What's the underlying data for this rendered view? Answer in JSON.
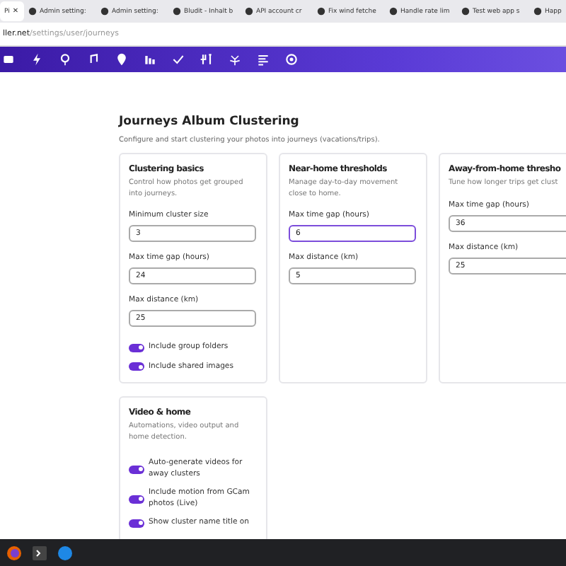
{
  "browser": {
    "tabs": [
      {
        "label": "Pi",
        "selected": true,
        "close": "✕"
      },
      {
        "label": "Admin setting:",
        "selected": false
      },
      {
        "label": "Admin setting:",
        "selected": false
      },
      {
        "label": "Bludit - Inhalt b",
        "selected": false
      },
      {
        "label": "API account cr",
        "selected": false
      },
      {
        "label": "Fix wind fetche",
        "selected": false
      },
      {
        "label": "Handle rate lim",
        "selected": false
      },
      {
        "label": "Test web app s",
        "selected": false
      },
      {
        "label": "Happ",
        "selected": false
      }
    ],
    "address": {
      "host": "ller.net",
      "path": "/settings/user/journeys"
    }
  },
  "page": {
    "title": "Journeys Album Clustering",
    "subtitle": "Configure and start clustering your photos into journeys (vacations/trips).",
    "cards": [
      {
        "title": "Clustering basics",
        "description": "Control how photos get grouped into journeys.",
        "fields": [
          {
            "label": "Minimum cluster size",
            "value": "3",
            "focused": false
          },
          {
            "label": "Max time gap (hours)",
            "value": "24",
            "focused": false
          },
          {
            "label": "Max distance (km)",
            "value": "25",
            "focused": false
          }
        ],
        "toggles": [
          {
            "label": "Include group folders",
            "on": true
          },
          {
            "label": "Include shared images",
            "on": true
          }
        ]
      },
      {
        "title": "Near-home thresholds",
        "description": "Manage day-to-day movement close to home.",
        "fields": [
          {
            "label": "Max time gap (hours)",
            "value": "6",
            "focused": true
          },
          {
            "label": "Max distance (km)",
            "value": "5",
            "focused": false
          }
        ]
      },
      {
        "title": "Away-from-home thresho",
        "description": "Tune how longer trips get clust",
        "fields": [
          {
            "label": "Max time gap (hours)",
            "value": "36",
            "focused": false
          },
          {
            "label": "Max distance (km)",
            "value": "25",
            "focused": false
          }
        ]
      },
      {
        "title": "Video & home",
        "description": "Automations, video output and home detection.",
        "toggles": [
          {
            "label": "Auto-generate videos for away clusters",
            "on": true
          },
          {
            "label": "Include motion from GCam photos (Live)",
            "on": true
          },
          {
            "label": "Show cluster name title on",
            "on": true
          }
        ]
      }
    ]
  }
}
